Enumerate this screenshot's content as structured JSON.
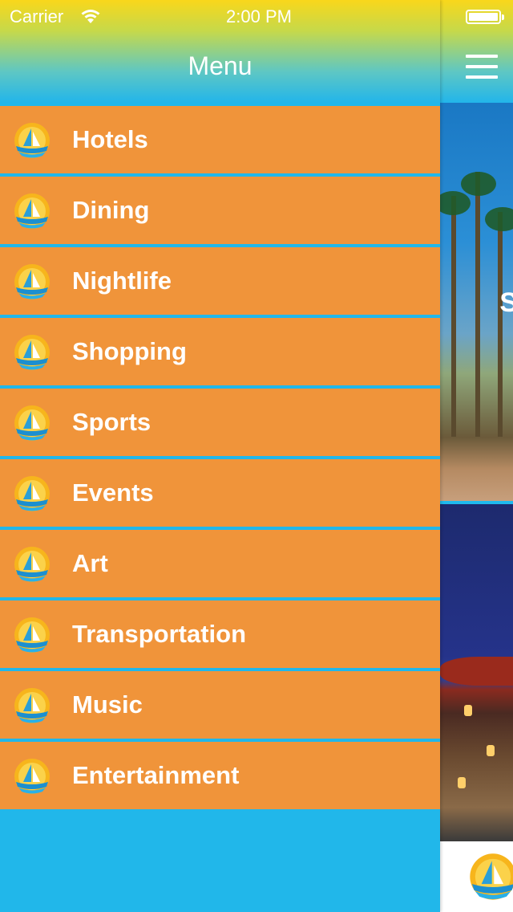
{
  "status_bar": {
    "carrier": "Carrier",
    "time": "2:00 PM"
  },
  "menu": {
    "title": "Menu",
    "items": [
      {
        "label": "Hotels",
        "icon": "sailboat-logo-icon"
      },
      {
        "label": "Dining",
        "icon": "sailboat-logo-icon"
      },
      {
        "label": "Nightlife",
        "icon": "sailboat-logo-icon"
      },
      {
        "label": "Shopping",
        "icon": "sailboat-logo-icon"
      },
      {
        "label": "Sports",
        "icon": "sailboat-logo-icon"
      },
      {
        "label": "Events",
        "icon": "sailboat-logo-icon"
      },
      {
        "label": "Art",
        "icon": "sailboat-logo-icon"
      },
      {
        "label": "Transportation",
        "icon": "sailboat-logo-icon"
      },
      {
        "label": "Music",
        "icon": "sailboat-logo-icon"
      },
      {
        "label": "Entertainment",
        "icon": "sailboat-logo-icon"
      }
    ]
  },
  "peek": {
    "hero_letter": "S"
  },
  "colors": {
    "menu_item_bg": "#f0943a",
    "panel_bg": "#21b7ea",
    "header_top": "#f9d71b",
    "header_bottom": "#22b5ea"
  }
}
